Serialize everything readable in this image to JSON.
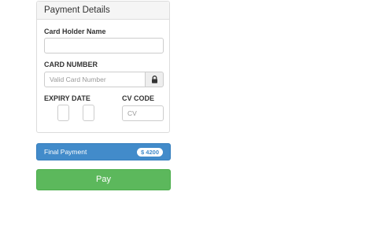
{
  "panel": {
    "title": "Payment Details"
  },
  "form": {
    "holder_label": "Card Holder Name",
    "holder_value": "",
    "card_label": "CARD NUMBER",
    "card_placeholder": "Valid Card Number",
    "expiry_label": "EXPIRY DATE",
    "cvv_label": "CV CODE",
    "cvv_placeholder": "CV"
  },
  "summary": {
    "label": "Final Payment",
    "amount": "$ 4200"
  },
  "actions": {
    "pay_label": "Pay"
  },
  "colors": {
    "primary": "#428bca",
    "success": "#5cb85c"
  },
  "icons": {
    "card_lock": "lock-icon"
  }
}
